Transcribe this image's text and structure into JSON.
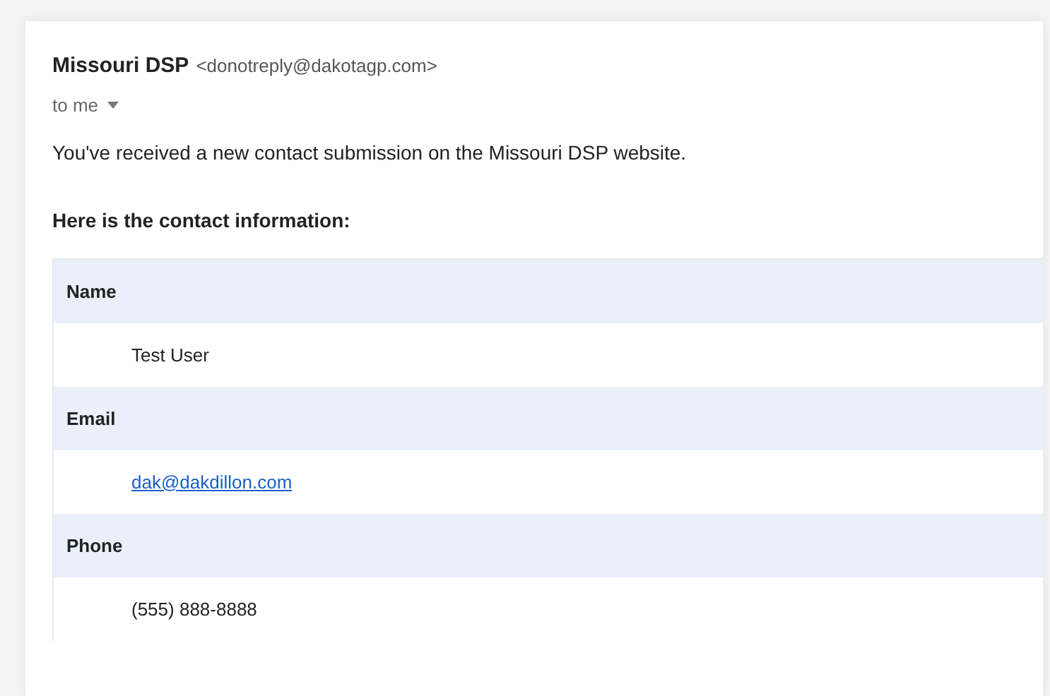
{
  "sender": {
    "name": "Missouri DSP",
    "address": "<donotreply@dakotagp.com>"
  },
  "recipient": {
    "label": "to me"
  },
  "intro": "You've received a new contact submission on the Missouri DSP website.",
  "heading": "Here is the contact information:",
  "fields": [
    {
      "label": "Name",
      "value": "Test User",
      "kind": "text"
    },
    {
      "label": "Email",
      "value": "dak@dakdillon.com",
      "kind": "link"
    },
    {
      "label": "Phone",
      "value": "(555) 888-8888",
      "kind": "text"
    }
  ]
}
